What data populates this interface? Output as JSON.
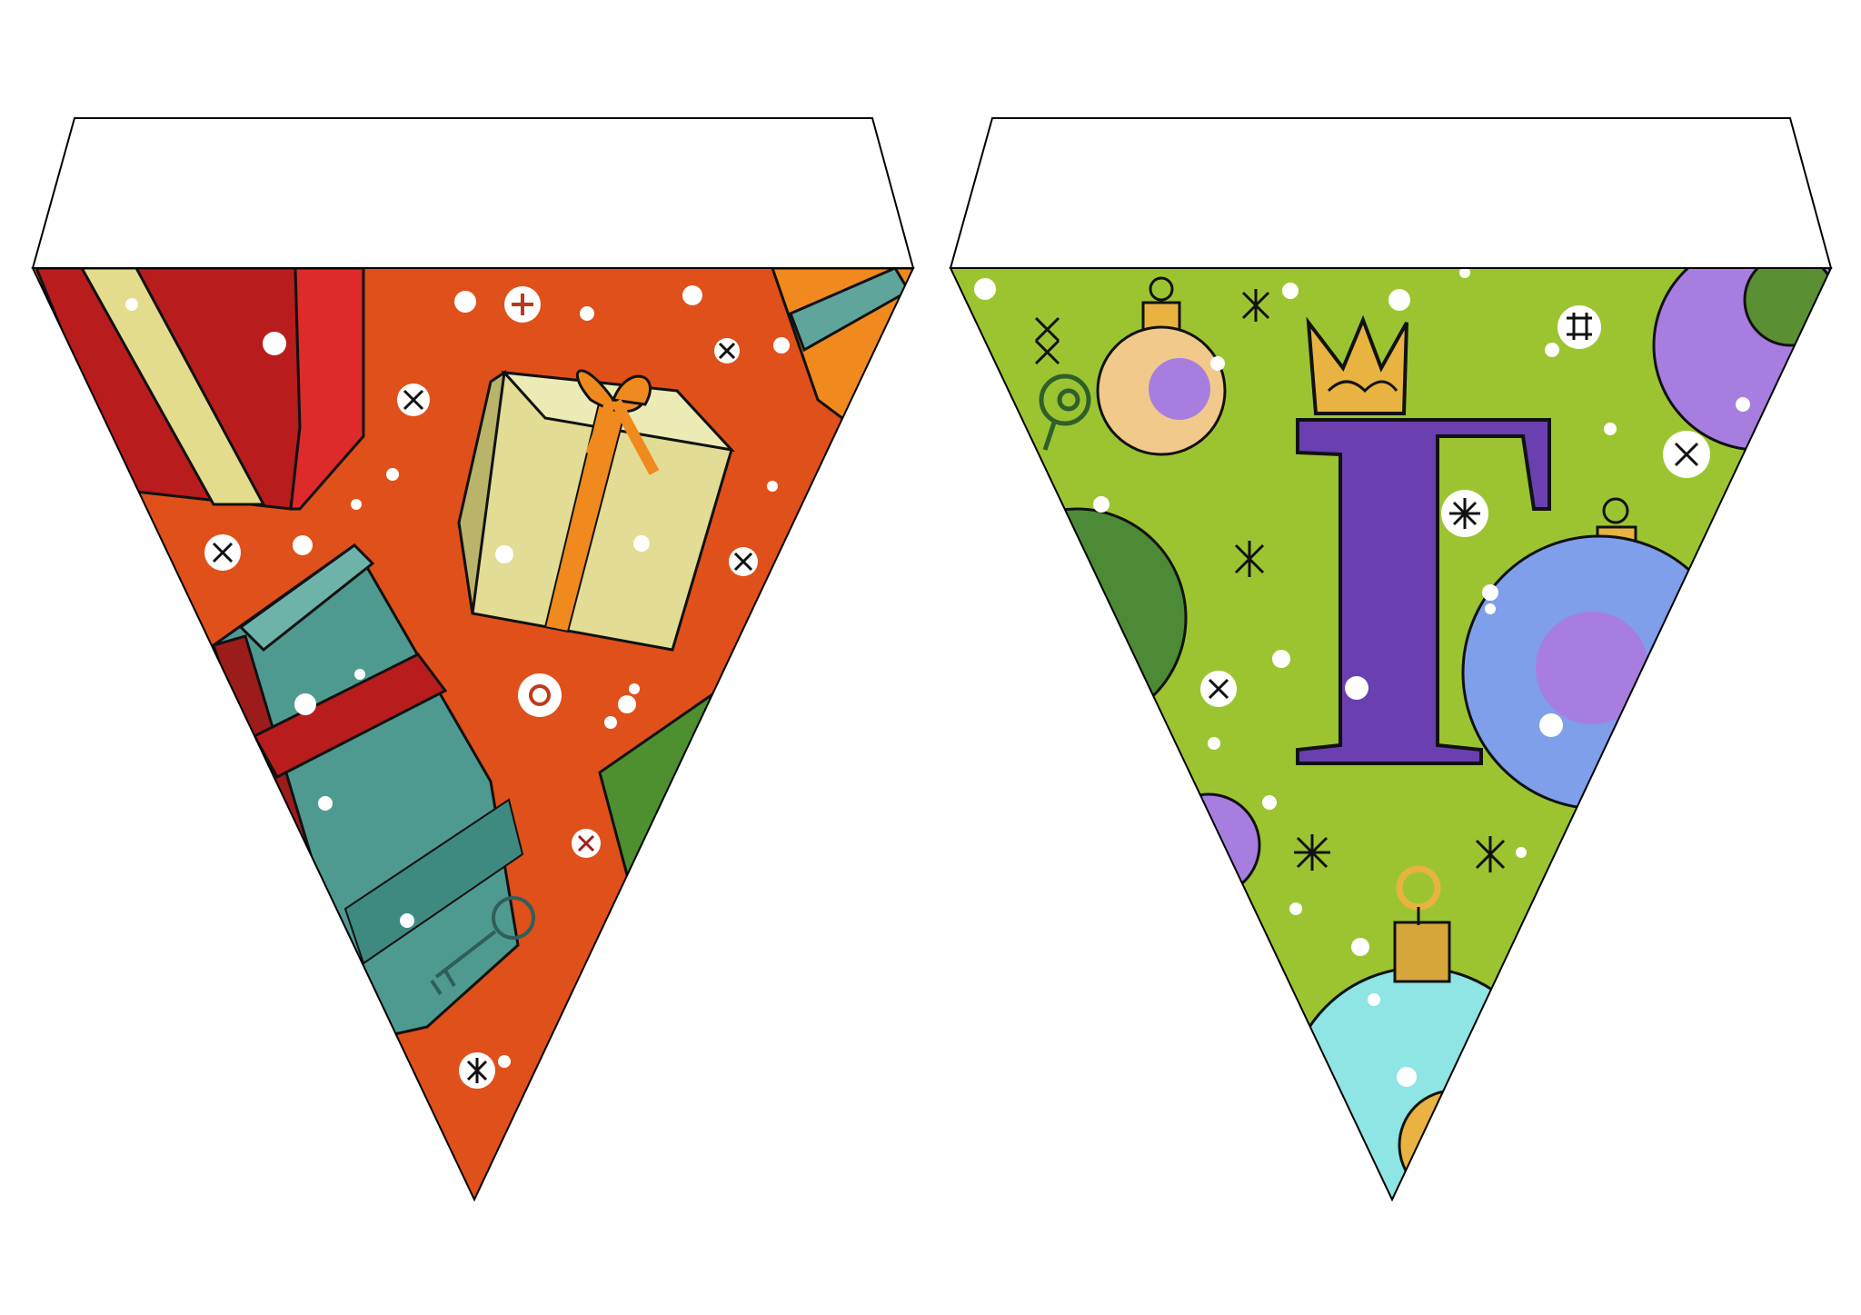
{
  "flags": [
    {
      "letter": "",
      "theme": "gifts",
      "background_color": "#e0501a",
      "icons": [
        "gift-box-icon",
        "key-icon",
        "snowflake-icon"
      ]
    },
    {
      "letter": "Г",
      "theme": "ornaments",
      "background_color": "#9cc431",
      "letter_color": "#6a3fb0",
      "icons": [
        "crown-icon",
        "ornament-ball-icon",
        "key-icon",
        "snowflake-icon"
      ]
    }
  ],
  "colors": {
    "fold_tab": "#ffffff",
    "outline": "#000000",
    "snow": "#ffffff"
  }
}
